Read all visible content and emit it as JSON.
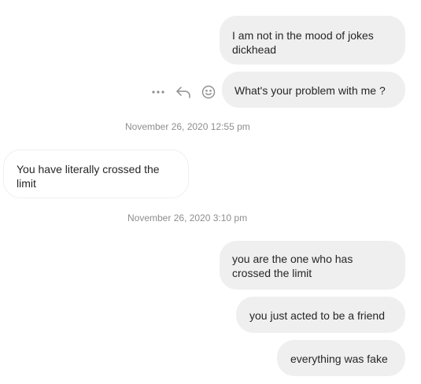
{
  "messages": [
    {
      "direction": "outgoing",
      "text": "I am not in the mood of jokes dickhead"
    },
    {
      "direction": "outgoing",
      "text": "What's your problem with me ?"
    },
    {
      "direction": "incoming",
      "text": "You have literally crossed the limit"
    },
    {
      "direction": "outgoing",
      "text": "you are the one who has crossed the limit"
    },
    {
      "direction": "outgoing",
      "text": "you just acted to be a friend"
    },
    {
      "direction": "outgoing",
      "text": "everything was fake"
    }
  ],
  "timestamps": [
    "November 26, 2020 12:55 pm",
    "November 26, 2020 3:10 pm"
  ],
  "message_actions": {
    "icons": [
      "more-options-icon",
      "reply-icon",
      "emoji-react-icon"
    ]
  },
  "colors": {
    "outgoing_bubble": "#efefef",
    "incoming_border": "#efefef",
    "text": "#262626",
    "timestamp": "#8e8e8e",
    "icon": "#8e8e8e"
  }
}
